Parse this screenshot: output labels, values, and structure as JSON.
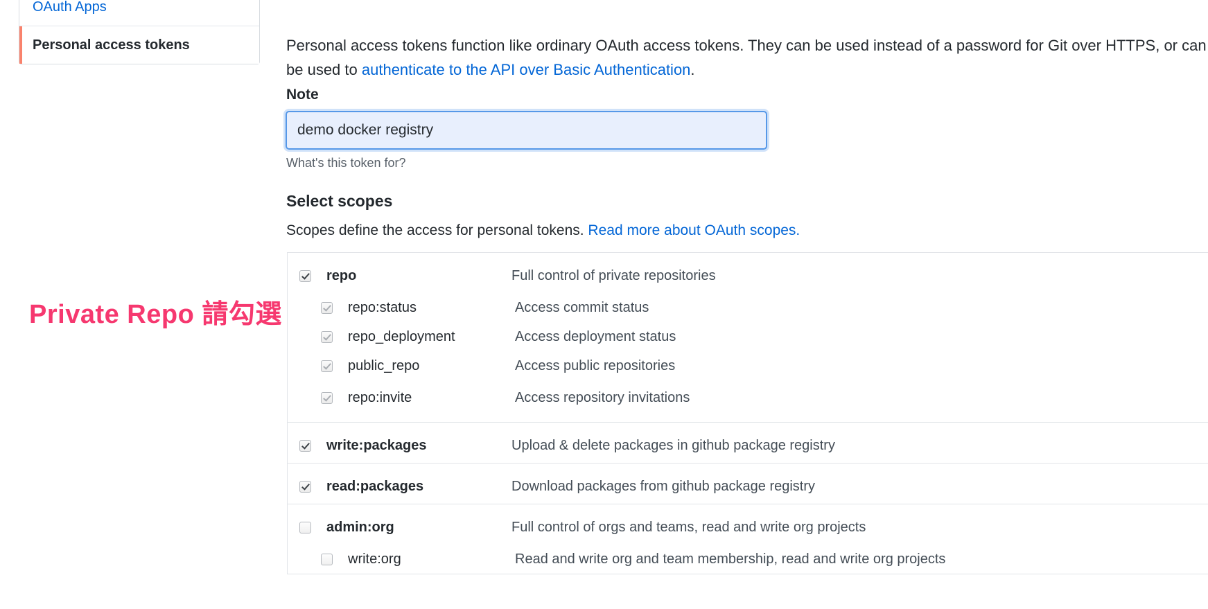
{
  "sidebar": {
    "items": [
      {
        "label": "OAuth Apps",
        "state": "link"
      },
      {
        "label": "Personal access tokens",
        "state": "active"
      }
    ]
  },
  "main": {
    "intro": {
      "part1": "Personal access tokens function like ordinary OAuth access tokens. They can be used instead of a password for Git over HTTPS, or can be used to ",
      "link": "authenticate to the API over Basic Authentication",
      "part2": "."
    },
    "note": {
      "label": "Note",
      "value": "demo docker registry",
      "placeholder": "What's this token for?",
      "hint": "What's this token for?"
    },
    "scopes": {
      "label": "Select scopes",
      "desc_part1": "Scopes define the access for personal tokens. ",
      "desc_link": "Read more about OAuth scopes.",
      "groups": [
        {
          "parent": {
            "name": "repo",
            "desc": "Full control of private repositories",
            "checked": true,
            "dim": false
          },
          "children": [
            {
              "name": "repo:status",
              "desc": "Access commit status",
              "checked": true,
              "dim": true
            },
            {
              "name": "repo_deployment",
              "desc": "Access deployment status",
              "checked": true,
              "dim": true
            },
            {
              "name": "public_repo",
              "desc": "Access public repositories",
              "checked": true,
              "dim": true
            },
            {
              "name": "repo:invite",
              "desc": "Access repository invitations",
              "checked": true,
              "dim": true
            }
          ]
        },
        {
          "parent": {
            "name": "write:packages",
            "desc": "Upload & delete packages in github package registry",
            "checked": true,
            "dim": false
          },
          "children": []
        },
        {
          "parent": {
            "name": "read:packages",
            "desc": "Download packages from github package registry",
            "checked": true,
            "dim": false
          },
          "children": []
        },
        {
          "parent": {
            "name": "admin:org",
            "desc": "Full control of orgs and teams, read and write org projects",
            "checked": false,
            "dim": false
          },
          "children": [
            {
              "name": "write:org",
              "desc": "Read and write org and team membership, read and write org projects",
              "checked": false,
              "dim": false
            }
          ]
        }
      ]
    }
  },
  "annotation": {
    "text": "Private Repo 請勾選",
    "color": "#f6386f"
  },
  "colors": {
    "link": "#0366d6",
    "active_marker": "#f9826c",
    "input_focus_border": "#5698e8",
    "input_focus_bg": "#e8effd",
    "annotation": "#f6386f"
  }
}
